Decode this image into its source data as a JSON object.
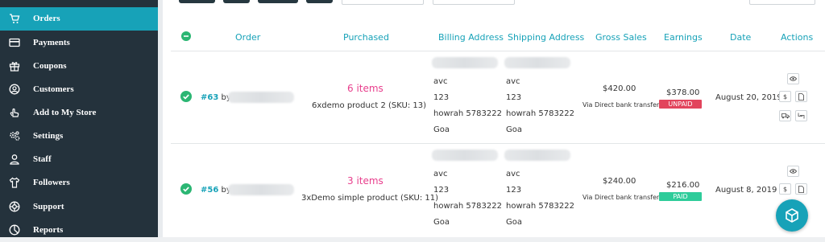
{
  "sidebar": {
    "items": [
      {
        "label": "Orders",
        "icon": "cart-icon"
      },
      {
        "label": "Payments",
        "icon": "credit-card-icon"
      },
      {
        "label": "Coupons",
        "icon": "gift-icon"
      },
      {
        "label": "Customers",
        "icon": "user-circle-icon"
      },
      {
        "label": "Add to My Store",
        "icon": "hand-pointer-icon"
      },
      {
        "label": "Settings",
        "icon": "cogs-icon"
      },
      {
        "label": "Staff",
        "icon": "user-icon"
      },
      {
        "label": "Followers",
        "icon": "shirt-icon"
      },
      {
        "label": "Support",
        "icon": "lifebuoy-icon"
      },
      {
        "label": "Reports",
        "icon": "pie-chart-icon"
      }
    ]
  },
  "table": {
    "headers": {
      "order": "Order",
      "purchased": "Purchased",
      "billing": "Billing Address",
      "shipping": "Shipping Address",
      "gross": "Gross Sales",
      "earnings": "Earnings",
      "date": "Date",
      "actions": "Actions"
    },
    "rows": [
      {
        "order_num": "#63",
        "by": "by",
        "items_count": "6 items",
        "product": "6xdemo product 2 (SKU: 13)",
        "billing": [
          "avc",
          "123",
          "howrah 5783222",
          "Goa"
        ],
        "shipping": [
          "avc",
          "123",
          "howrah 5783222",
          "Goa"
        ],
        "gross": "$420.00",
        "via": "Via Direct bank transfer",
        "earnings": "$378.00",
        "status": "UNPAID",
        "date": "August 20, 2019"
      },
      {
        "order_num": "#56",
        "by": "by",
        "items_count": "3 items",
        "product": "3xDemo simple product (SKU: 11)",
        "billing": [
          "avc",
          "123",
          "howrah 5783222",
          "Goa"
        ],
        "shipping": [
          "avc",
          "123",
          "howrah 5783222",
          "Goa"
        ],
        "gross": "$240.00",
        "via": "Via Direct bank transfer",
        "earnings": "$216.00",
        "status": "PAID",
        "date": "August 8, 2019"
      }
    ]
  },
  "actions": {
    "dollar": "$"
  },
  "colors": {
    "accent": "#17a2b8",
    "sidebar": "#24323c",
    "unpaid": "#e2445c",
    "paid": "#2ecc9a",
    "items": "#e83e8c",
    "check": "#2bb673"
  }
}
